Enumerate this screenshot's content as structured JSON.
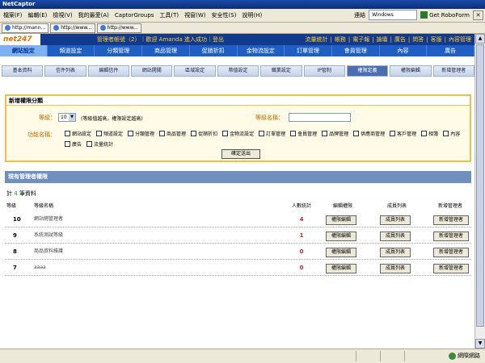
{
  "window": {
    "title": "NetCaptor"
  },
  "menubar": {
    "items": [
      "檔案(F)",
      "編輯(E)",
      "檢視(V)",
      "我的最愛(A)",
      "CaptorGroups",
      "工具(T)",
      "視窗(W)",
      "安全性(S)",
      "說明(H)"
    ],
    "go_label": "連結",
    "windows_label": "Windows",
    "roboform_label": "Get RoboForm"
  },
  "browser_tabs": [
    {
      "label": "http://mann...",
      "active": true
    },
    {
      "label": "http://www...",
      "active": false
    },
    {
      "label": "http://www...",
      "active": false
    }
  ],
  "header": {
    "logo": "net247",
    "user_text": "管理者帳號（2）｜歡迎 Amanda 進入成功｜登出",
    "right_links": [
      "流量統計",
      "帳務",
      "電子報",
      "論壇",
      "廣告",
      "問答",
      "客服",
      "內容管理"
    ]
  },
  "nav_primary": [
    "網站設定",
    "頻道設定",
    "分類管理",
    "商品管理",
    "促銷折扣",
    "金物流設定",
    "訂單管理",
    "會員管理",
    "內容",
    "廣告"
  ],
  "nav_secondary": [
    "基本資料",
    "信件列表",
    "編輯信件",
    "網站開關",
    "區域設定",
    "幣值設定",
    "職業設定",
    "IP管制",
    "權限定義",
    "權限編輯",
    "新增管理者"
  ],
  "add_form": {
    "title": "新增權限分類",
    "level_label": "等級：",
    "level_value": "10",
    "level_hint": "(等級值越高，權限設定越高)",
    "name_label": "等級名稱：",
    "func_label": "功能名稱：",
    "functions": [
      "網站設定",
      "頻道設定",
      "分類管理",
      "商品管理",
      "促銷折扣",
      "金物流設定",
      "訂單管理",
      "會員管理",
      "品牌管理",
      "供應商管理",
      "客戶管理",
      "相簿",
      "內容",
      "廣告",
      "流量統計"
    ],
    "submit_label": "確定送出"
  },
  "list": {
    "title": "現有管理者權限",
    "count_prefix": "計",
    "count_value": "4",
    "count_suffix": "筆資料",
    "columns": [
      "等級",
      "等級名稱",
      "人數統計",
      "編輯權限",
      "成員列表",
      "新增管理者"
    ],
    "rows": [
      {
        "level": "10",
        "name": "網站總管理者",
        "count": "4",
        "edit": "權限編輯",
        "members": "成員列表",
        "add": "新增管理者"
      },
      {
        "level": "9",
        "name": "系統測試等級",
        "count": "1",
        "edit": "權限編輯",
        "members": "成員列表",
        "add": "新增管理者"
      },
      {
        "level": "8",
        "name": "商品資料維護",
        "count": "0",
        "edit": "權限編輯",
        "members": "成員列表",
        "add": "新增管理者"
      },
      {
        "level": "7",
        "name": "aaaa",
        "count": "0",
        "edit": "權限編輯",
        "members": "成員列表",
        "add": "新增管理者"
      }
    ]
  },
  "status_bar": {
    "zone": "網際網路"
  },
  "colors": {
    "header_bg": "#123a8c",
    "nav_bg": "#1f5fc4",
    "accent": "#f0c040",
    "count_red": "#d02020"
  }
}
